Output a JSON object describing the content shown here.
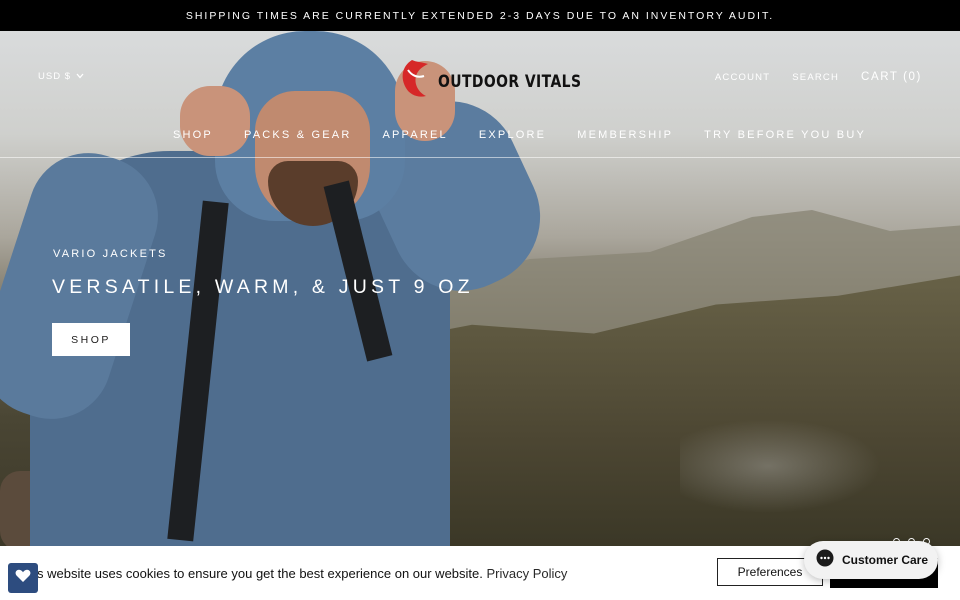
{
  "announcement": "SHIPPING TIMES ARE CURRENTLY EXTENDED 2-3 DAYS DUE TO AN INVENTORY AUDIT.",
  "header": {
    "currency": "USD $",
    "logo_text": "OUTDOOR VITALS",
    "account": "ACCOUNT",
    "search": "SEARCH",
    "cart": "CART (0)"
  },
  "nav": {
    "items": [
      {
        "label": "SHOP"
      },
      {
        "label": "PACKS & GEAR"
      },
      {
        "label": "APPAREL"
      },
      {
        "label": "EXPLORE"
      },
      {
        "label": "MEMBERSHIP"
      },
      {
        "label": "TRY BEFORE YOU BUY"
      }
    ]
  },
  "hero": {
    "eyebrow": "VARIO JACKETS",
    "headline": "VERSATILE, WARM, & JUST 9 OZ",
    "cta": "SHOP"
  },
  "cookie": {
    "text": "s website uses cookies to ensure you get the best experience on our website.",
    "privacy_link": "Privacy Policy",
    "preferences_label": "Preferences"
  },
  "chat": {
    "label": "Customer Care"
  },
  "colors": {
    "announcement_bg": "#000000",
    "logo_red": "#d62828",
    "heart_button": "#2d4c7f"
  },
  "icons": [
    "chevron-down-icon",
    "logo-mark-icon",
    "heart-icon",
    "chat-bubble-icon"
  ]
}
